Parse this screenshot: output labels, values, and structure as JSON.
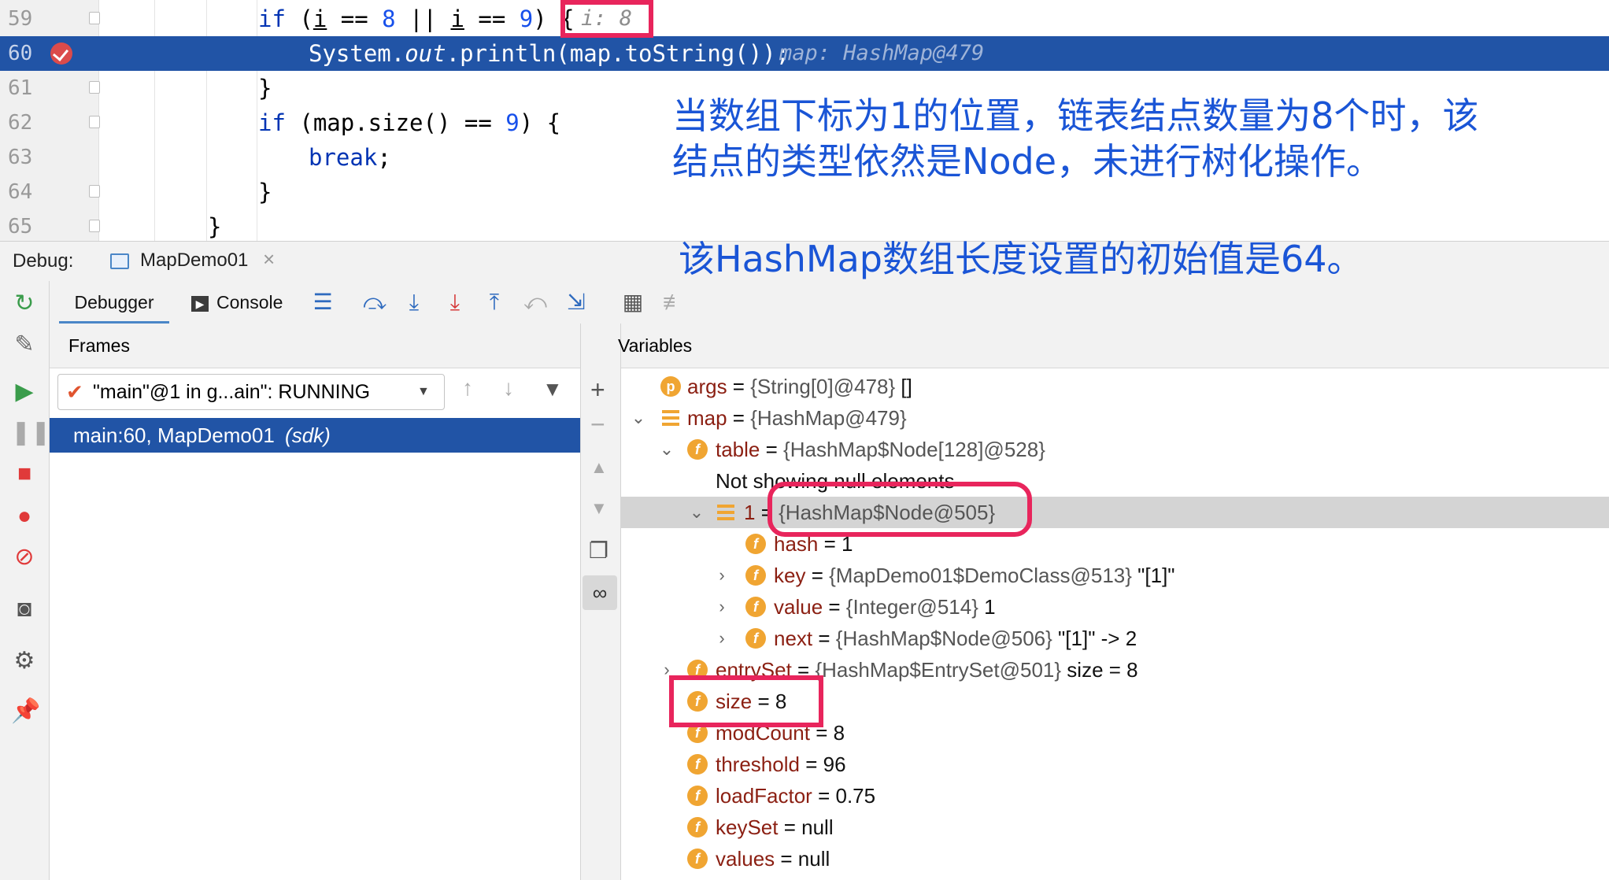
{
  "editor": {
    "lines": [
      {
        "num": "59"
      },
      {
        "num": "60"
      },
      {
        "num": "61"
      },
      {
        "num": "62"
      },
      {
        "num": "63"
      },
      {
        "num": "64"
      },
      {
        "num": "65"
      }
    ],
    "l59": {
      "if": "if",
      "a": " (",
      "i1": "i",
      "b": " == ",
      "n8": "8",
      "c": " || ",
      "i2": "i",
      "d": " == ",
      "n9": "9",
      "e": ") {",
      "hint": "i: 8"
    },
    "l60": {
      "a": "System.",
      "out": "out",
      "b": ".println(map.toString());",
      "hint": "map: HashMap@479"
    },
    "l61": {
      "text": "}"
    },
    "l62": {
      "if": "if",
      "a": " (map.size() == ",
      "n9": "9",
      "b": ") {"
    },
    "l63": {
      "brk": "break",
      "semi": ";"
    },
    "l64": {
      "text": "}"
    },
    "l65": {
      "text": "}"
    }
  },
  "annotations": {
    "line1": "当数组下标为1的位置，链表结点数量为8个时，该",
    "line2": "结点的类型依然是Node，未进行树化操作。",
    "line3": "该HashMap数组长度设置的初始值是64。"
  },
  "debug": {
    "label": "Debug:",
    "session_tab": "MapDemo01",
    "close": "×",
    "tabs": {
      "debugger": "Debugger",
      "console": "Console"
    }
  },
  "frames": {
    "header": "Frames",
    "thread": "\"main\"@1 in g...ain\": RUNNING",
    "frame_main": "main:60, MapDemo01",
    "frame_sdk": "(sdk)"
  },
  "variables": {
    "header": "Variables",
    "rows": [
      {
        "name": "args",
        "eq": " = ",
        "val": "{String[0]@478}",
        "extra": " []"
      },
      {
        "name": "map",
        "eq": " = ",
        "val": "{HashMap@479}",
        "extra": ""
      },
      {
        "name": "table",
        "eq": " = ",
        "val": "{HashMap$Node[128]@528}",
        "extra": ""
      },
      {
        "name": "Not showing null elements",
        "eq": "",
        "val": "",
        "extra": ""
      },
      {
        "name": "1",
        "eq": " = ",
        "val": "{HashMap$Node@505}",
        "extra": ""
      },
      {
        "name": "hash",
        "eq": " = ",
        "val": "1",
        "extra": ""
      },
      {
        "name": "key",
        "eq": " = ",
        "val": "{MapDemo01$DemoClass@513}",
        "extra": " \"[1]\""
      },
      {
        "name": "value",
        "eq": " = ",
        "val": "{Integer@514}",
        "extra": " 1"
      },
      {
        "name": "next",
        "eq": " = ",
        "val": "{HashMap$Node@506}",
        "extra": " \"[1]\" -> 2"
      },
      {
        "name": "entrySet",
        "eq": " = ",
        "val": "{HashMap$EntrySet@501}",
        "extra": "  size = 8"
      },
      {
        "name": "size",
        "eq": " = ",
        "val": "8",
        "extra": ""
      },
      {
        "name": "modCount",
        "eq": " = ",
        "val": "8",
        "extra": ""
      },
      {
        "name": "threshold",
        "eq": " = ",
        "val": "96",
        "extra": ""
      },
      {
        "name": "loadFactor",
        "eq": " = ",
        "val": "0.75",
        "extra": ""
      },
      {
        "name": "keySet",
        "eq": " = ",
        "val": "null",
        "extra": ""
      },
      {
        "name": "values",
        "eq": " = ",
        "val": "null",
        "extra": ""
      }
    ]
  },
  "icons": {
    "field": "f",
    "param": "p",
    "expand": "›",
    "collapse": "⌄",
    "dropdown": "▼",
    "check": "✔"
  },
  "colors": {
    "highlight": "#2154a6",
    "annotation": "#1a55d6",
    "callout": "#e8255c",
    "field_icon": "#f0a532"
  }
}
